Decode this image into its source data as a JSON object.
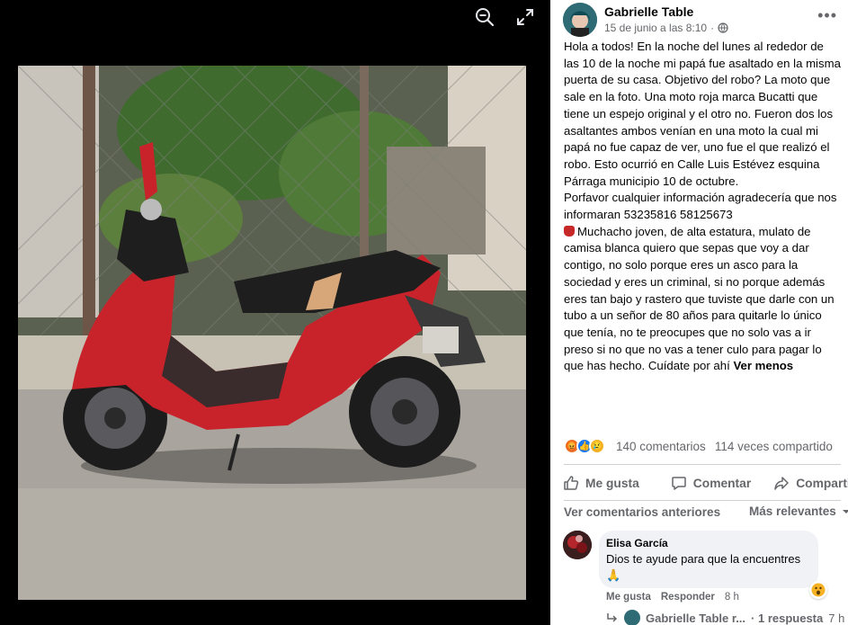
{
  "viewer": {
    "zoom_icon": "zoom-out-icon",
    "fullscreen_icon": "fullscreen-icon",
    "photo_alt": "Moto roja Bucatti"
  },
  "post": {
    "author": "Gabrielle Table",
    "date": "15 de junio a las 8:10",
    "audience_icon": "globe-icon",
    "more_label": "•••",
    "paragraphs": [
      "Hola a todos! En la noche del lunes al rededor de las 10 de la noche mi papá fue asaltado en la misma puerta de su casa. Objetivo del robo? La moto que sale en la foto. Una moto roja marca Bucatti que tiene un espejo original y el otro no. Fueron dos los asaltantes ambos venían en una moto la cual mi papá no fue capaz de ver, uno fue el que realizó el robo. Esto ocurrió en Calle Luis Estévez esquina Párraga municipio 10 de octubre.",
      "Porfavor cualquier información agradecería que nos informaran 53235816 58125673"
    ],
    "last_paragraph": "Muchacho joven, de alta estatura, mulato de camisa blanca quiero que sepas que voy a dar contigo, no solo porque eres un asco para la sociedad y eres un criminal, si no porque además eres tan bajo y rastero que tuviste que darle con un tubo a un señor de 80 años para quitarle lo único que tenía, no te preocupes que no solo vas a ir preso si no que no vas a tener culo para pagar lo que has hecho. Cuídate por ahí",
    "see_less": "Ver menos"
  },
  "stats": {
    "reactions": [
      "angry",
      "like",
      "sad"
    ],
    "comments": "140 comentarios",
    "shares": "114 veces compartido"
  },
  "actions": {
    "like": "Me gusta",
    "comment": "Comentar",
    "share": "Compartir"
  },
  "comments_bar": {
    "previous": "Ver comentarios anteriores",
    "sort": "Más relevantes"
  },
  "comment": {
    "name": "Elisa García",
    "text": "Dios te ayude para que la encuentres 🙏",
    "reaction": "wow",
    "like": "Me gusta",
    "reply": "Responder",
    "time": "8 h"
  },
  "reply_preview": {
    "author": "Gabrielle Table r...",
    "count": "· 1 respuesta",
    "time": "7 h"
  },
  "colors": {
    "viewer_bg": "#000000",
    "accent": "#1877f2",
    "muted": "#65676b",
    "bike_red": "#c8232b"
  }
}
